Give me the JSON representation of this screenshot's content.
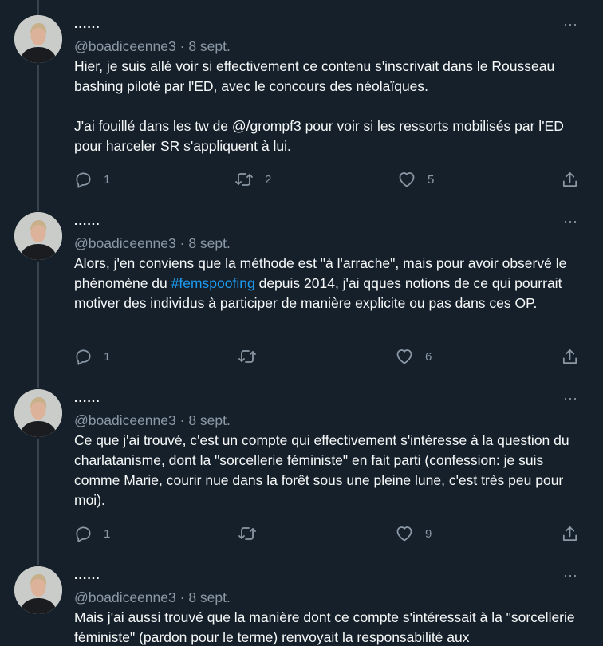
{
  "tweets": [
    {
      "name": "......",
      "handle": "@boadiceenne3",
      "separator": "·",
      "date": "8 sept.",
      "more": "···",
      "paragraphs": [
        "Hier, je suis allé voir si effectivement ce contenu s'inscrivait dans le Rousseau bashing piloté par l'ED, avec le concours des néolaïques.",
        "J'ai fouillé dans les tw de @/grompf3 pour voir si les ressorts mobilisés par l'ED pour harceler SR s'appliquent à lui."
      ],
      "replies": "1",
      "retweets": "2",
      "likes": "5"
    },
    {
      "name": "......",
      "handle": "@boadiceenne3",
      "separator": "·",
      "date": "8 sept.",
      "more": "···",
      "text_before": "Alors, j'en conviens que la méthode est \"à l'arrache\", mais pour avoir observé le phénomène du ",
      "hashtag": "#femspoofing",
      "text_after": " depuis 2014, j'ai qques notions de ce qui pourrait motiver des individus à participer de manière explicite ou pas dans ces OP.",
      "replies": "1",
      "retweets": "",
      "likes": "6"
    },
    {
      "name": "......",
      "handle": "@boadiceenne3",
      "separator": "·",
      "date": "8 sept.",
      "more": "···",
      "paragraphs": [
        "Ce que j'ai trouvé, c'est un compte qui effectivement s'intéresse à la question du charlatanisme, dont la \"sorcellerie féministe\" en fait parti (confession: je suis comme Marie, courir nue dans la forêt sous une pleine lune, c'est très peu pour moi)."
      ],
      "replies": "1",
      "retweets": "",
      "likes": "9"
    },
    {
      "name": "......",
      "handle": "@boadiceenne3",
      "separator": "·",
      "date": "8 sept.",
      "more": "···",
      "paragraphs": [
        "Mais j'ai aussi trouvé que la manière dont ce compte s'intéressait à la \"sorcellerie féministe\" (pardon pour le terme) renvoyait la responsabilité aux"
      ]
    }
  ],
  "colors": {
    "background": "#15202b",
    "text": "#f7f9f9",
    "secondary": "#8b98a5",
    "accent": "#1d9bf0",
    "thread_line": "#38444d"
  },
  "icons": [
    "reply-icon",
    "retweet-icon",
    "like-icon",
    "share-icon",
    "more-icon"
  ]
}
